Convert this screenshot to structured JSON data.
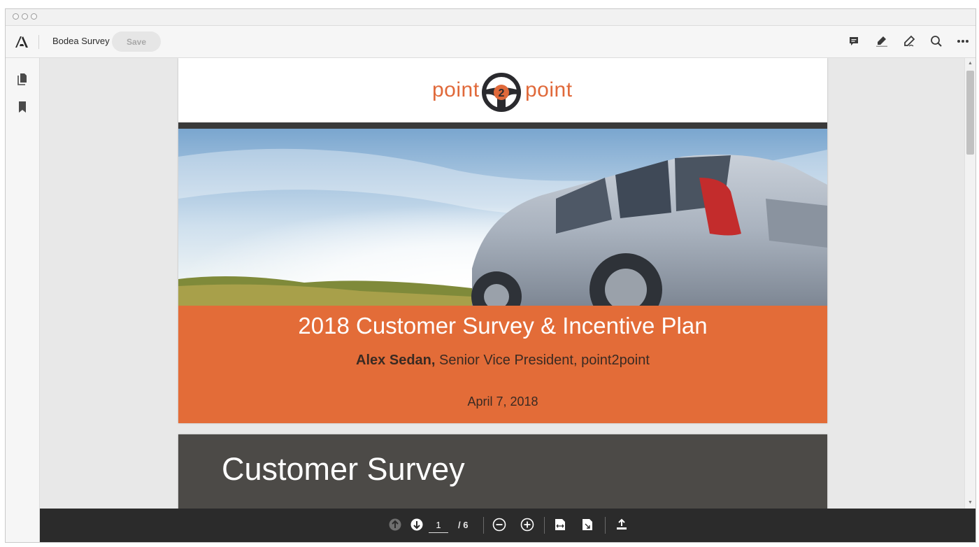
{
  "window": {
    "doc_title": "Bodea Survey"
  },
  "toolbar": {
    "save_label": "Save"
  },
  "slide1": {
    "brand_left": "point",
    "brand_number": "2",
    "brand_right": "point",
    "title": "2018 Customer Survey & Incentive Plan",
    "presenter_name": "Alex Sedan,",
    "presenter_role": " Senior Vice President, point2point",
    "date": "April 7, 2018"
  },
  "slide2": {
    "title": "Customer Survey"
  },
  "navigation": {
    "current_page": "1",
    "total_pages": "/ 6"
  },
  "colors": {
    "accent_orange": "#e36c38",
    "brand_text": "#e0693a",
    "bottombar": "#2b2b2b"
  }
}
